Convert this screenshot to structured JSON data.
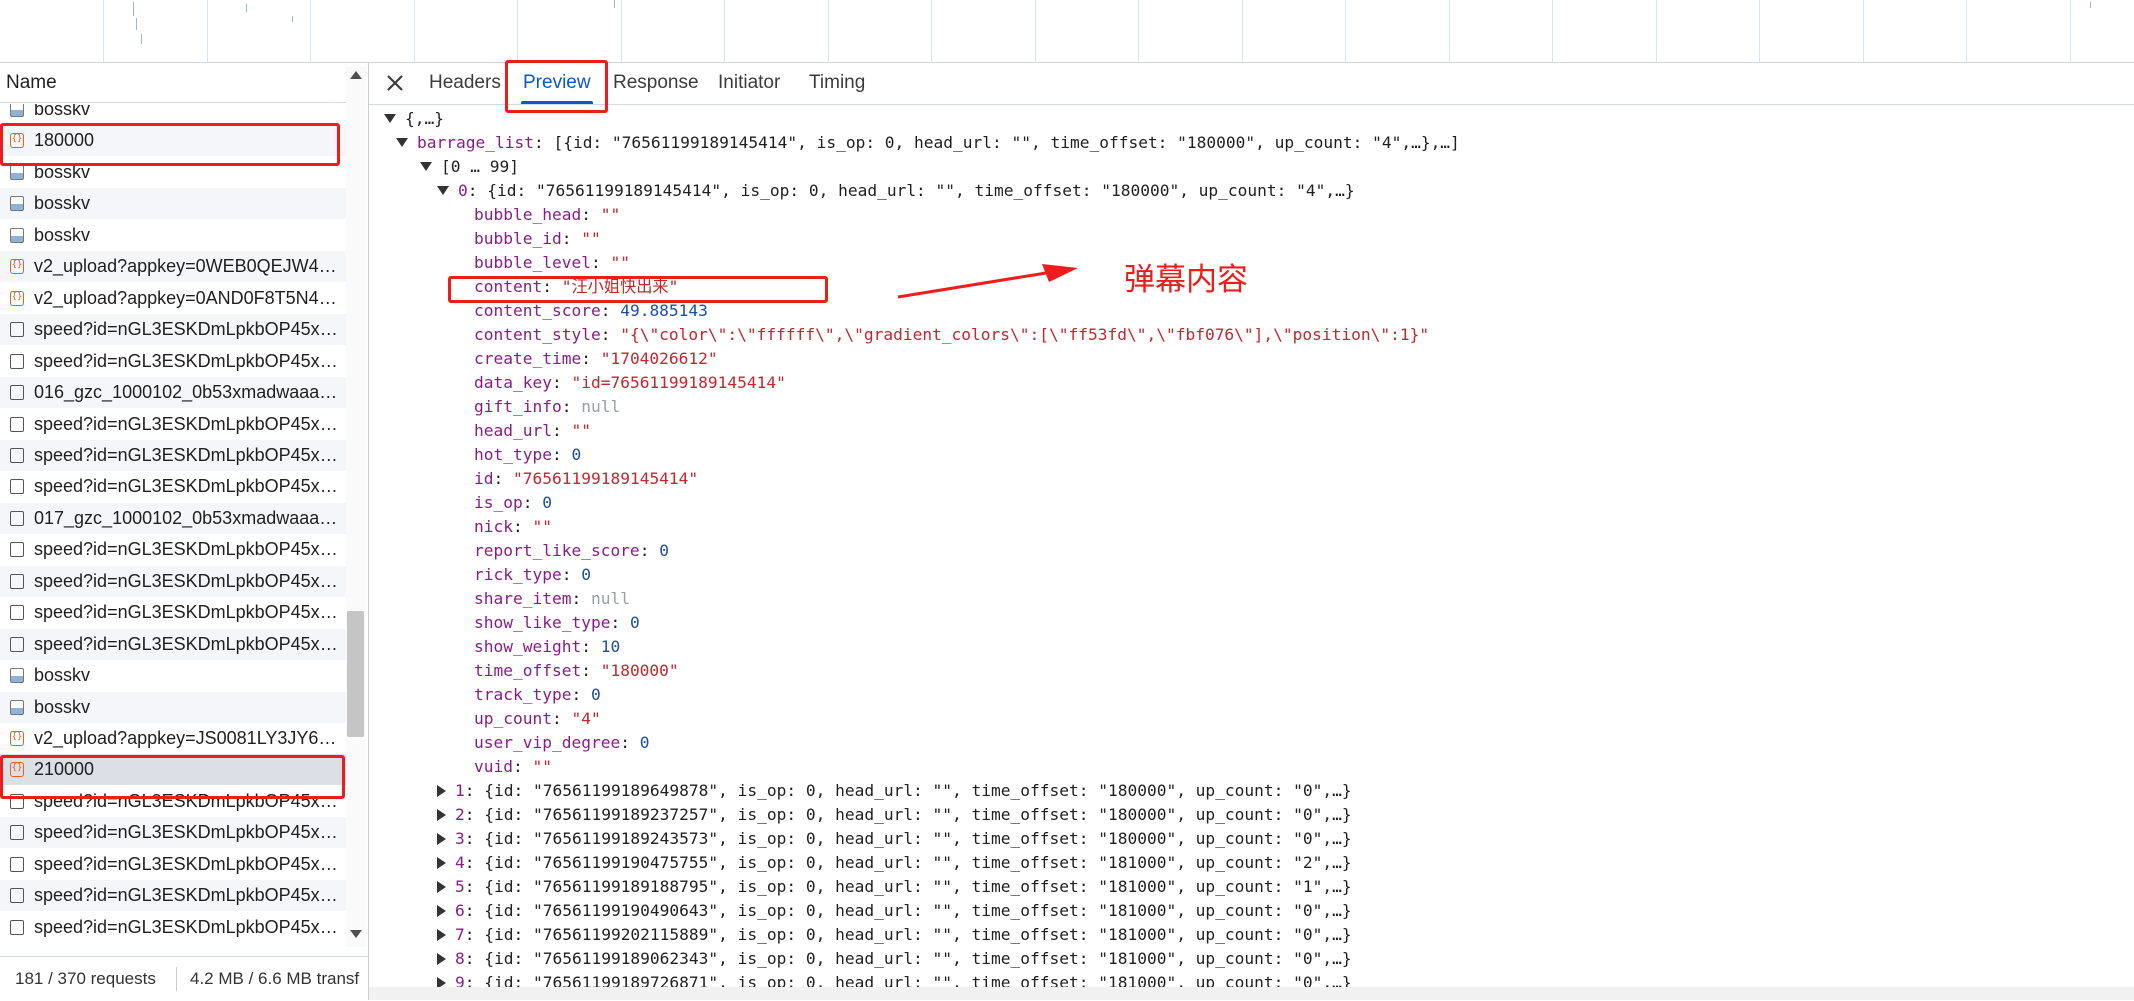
{
  "status": {
    "requests": "181 / 370 requests",
    "transferred": "4.2 MB / 6.6 MB transf"
  },
  "name_column": "Name",
  "requests": [
    {
      "name": "bosskv",
      "icon": "image-icon"
    },
    {
      "name": "180000",
      "icon": "xhr-icon"
    },
    {
      "name": "bosskv",
      "icon": "image-icon"
    },
    {
      "name": "bosskv",
      "icon": "image-icon"
    },
    {
      "name": "bosskv",
      "icon": "image-icon"
    },
    {
      "name": "v2_upload?appkey=0WEB0QEJW44K...",
      "icon": "xhr-icon"
    },
    {
      "name": "v2_upload?appkey=0AND0F8T5N4N...",
      "icon": "xhr-icon"
    },
    {
      "name": "speed?id=nGL3ESKDmLpkbOP45x&...",
      "icon": "document-icon"
    },
    {
      "name": "speed?id=nGL3ESKDmLpkbOP45x&...",
      "icon": "document-icon"
    },
    {
      "name": "016_gzc_1000102_0b53xmadwaaazia...",
      "icon": "document-icon"
    },
    {
      "name": "speed?id=nGL3ESKDmLpkbOP45x&...",
      "icon": "document-icon"
    },
    {
      "name": "speed?id=nGL3ESKDmLpkbOP45x&...",
      "icon": "document-icon"
    },
    {
      "name": "speed?id=nGL3ESKDmLpkbOP45x&...",
      "icon": "document-icon"
    },
    {
      "name": "017_gzc_1000102_0b53xmadwaaazia...",
      "icon": "document-icon"
    },
    {
      "name": "speed?id=nGL3ESKDmLpkbOP45x&...",
      "icon": "document-icon"
    },
    {
      "name": "speed?id=nGL3ESKDmLpkbOP45x&...",
      "icon": "document-icon"
    },
    {
      "name": "speed?id=nGL3ESKDmLpkbOP45x&...",
      "icon": "document-icon"
    },
    {
      "name": "speed?id=nGL3ESKDmLpkbOP45x&...",
      "icon": "document-icon"
    },
    {
      "name": "bosskv",
      "icon": "image-icon"
    },
    {
      "name": "bosskv",
      "icon": "image-icon"
    },
    {
      "name": "v2_upload?appkey=JS0081LY3JY6J3...",
      "icon": "xhr-icon"
    },
    {
      "name": "210000",
      "icon": "xhr-icon"
    },
    {
      "name": "speed?id=nGL3ESKDmLpkbOP45x&...",
      "icon": "document-icon"
    },
    {
      "name": "speed?id=nGL3ESKDmLpkbOP45x&...",
      "icon": "document-icon"
    },
    {
      "name": "speed?id=nGL3ESKDmLpkbOP45x&...",
      "icon": "document-icon"
    },
    {
      "name": "speed?id=nGL3ESKDmLpkbOP45x&...",
      "icon": "document-icon"
    },
    {
      "name": "speed?id=nGL3ESKDmLpkbOP45x&...",
      "icon": "document-icon"
    }
  ],
  "tabs": [
    "Headers",
    "Preview",
    "Response",
    "Initiator",
    "Timing"
  ],
  "active_tab": "Preview",
  "preview": {
    "root": "{,…}",
    "barrage_key": "barrage_list",
    "barrage_summary": "[{id: \"76561199189145414\", is_op: 0, head_url: \"\", time_offset: \"180000\", up_count: \"4\",…},…]",
    "range": "[0 … 99]",
    "item0_key": "0",
    "item0_summary": "{id: \"76561199189145414\", is_op: 0, head_url: \"\", time_offset: \"180000\", up_count: \"4\",…}",
    "fields": [
      {
        "key": "bubble_head",
        "value": "\"\"",
        "type": "string"
      },
      {
        "key": "bubble_id",
        "value": "\"\"",
        "type": "string"
      },
      {
        "key": "bubble_level",
        "value": "\"\"",
        "type": "string"
      },
      {
        "key": "content",
        "value": "\"汪小姐快出来\"",
        "type": "string"
      },
      {
        "key": "content_score",
        "value": "49.885143",
        "type": "number"
      },
      {
        "key": "content_style",
        "value": "\"{\\\"color\\\":\\\"ffffff\\\",\\\"gradient_colors\\\":[\\\"ff53fd\\\",\\\"fbf076\\\"],\\\"position\\\":1}\"",
        "type": "string"
      },
      {
        "key": "create_time",
        "value": "\"1704026612\"",
        "type": "string"
      },
      {
        "key": "data_key",
        "value": "\"id=76561199189145414\"",
        "type": "string"
      },
      {
        "key": "gift_info",
        "value": "null",
        "type": "null"
      },
      {
        "key": "head_url",
        "value": "\"\"",
        "type": "string"
      },
      {
        "key": "hot_type",
        "value": "0",
        "type": "number"
      },
      {
        "key": "id",
        "value": "\"76561199189145414\"",
        "type": "string"
      },
      {
        "key": "is_op",
        "value": "0",
        "type": "number"
      },
      {
        "key": "nick",
        "value": "\"\"",
        "type": "string"
      },
      {
        "key": "report_like_score",
        "value": "0",
        "type": "number"
      },
      {
        "key": "rick_type",
        "value": "0",
        "type": "number"
      },
      {
        "key": "share_item",
        "value": "null",
        "type": "null"
      },
      {
        "key": "show_like_type",
        "value": "0",
        "type": "number"
      },
      {
        "key": "show_weight",
        "value": "10",
        "type": "number"
      },
      {
        "key": "time_offset",
        "value": "\"180000\"",
        "type": "string"
      },
      {
        "key": "track_type",
        "value": "0",
        "type": "number"
      },
      {
        "key": "up_count",
        "value": "\"4\"",
        "type": "string"
      },
      {
        "key": "user_vip_degree",
        "value": "0",
        "type": "number"
      },
      {
        "key": "vuid",
        "value": "\"\"",
        "type": "string"
      }
    ],
    "collapsed_items": [
      {
        "key": "1",
        "summary": "{id: \"76561199189649878\", is_op: 0, head_url: \"\", time_offset: \"180000\", up_count: \"0\",…}"
      },
      {
        "key": "2",
        "summary": "{id: \"76561199189237257\", is_op: 0, head_url: \"\", time_offset: \"180000\", up_count: \"0\",…}"
      },
      {
        "key": "3",
        "summary": "{id: \"76561199189243573\", is_op: 0, head_url: \"\", time_offset: \"180000\", up_count: \"0\",…}"
      },
      {
        "key": "4",
        "summary": "{id: \"76561199190475755\", is_op: 0, head_url: \"\", time_offset: \"181000\", up_count: \"2\",…}"
      },
      {
        "key": "5",
        "summary": "{id: \"76561199189188795\", is_op: 0, head_url: \"\", time_offset: \"181000\", up_count: \"1\",…}"
      },
      {
        "key": "6",
        "summary": "{id: \"76561199190490643\", is_op: 0, head_url: \"\", time_offset: \"181000\", up_count: \"0\",…}"
      },
      {
        "key": "7",
        "summary": "{id: \"76561199202115889\", is_op: 0, head_url: \"\", time_offset: \"181000\", up_count: \"0\",…}"
      },
      {
        "key": "8",
        "summary": "{id: \"76561199189062343\", is_op: 0, head_url: \"\", time_offset: \"181000\", up_count: \"0\",…}"
      },
      {
        "key": "9",
        "summary": "{id: \"76561199189726871\", is_op: 0, head_url: \"\", time_offset: \"181000\", up_count: \"0\",…}"
      }
    ]
  },
  "annotation": {
    "label": "弹幕内容",
    "color": "#ee1c1c"
  },
  "colors": {
    "accent": "#0b57d0",
    "json_key": "#8a1c8a",
    "json_string": "#c6262e",
    "json_number": "#1a4fa0",
    "json_null": "#9aa0a6"
  }
}
